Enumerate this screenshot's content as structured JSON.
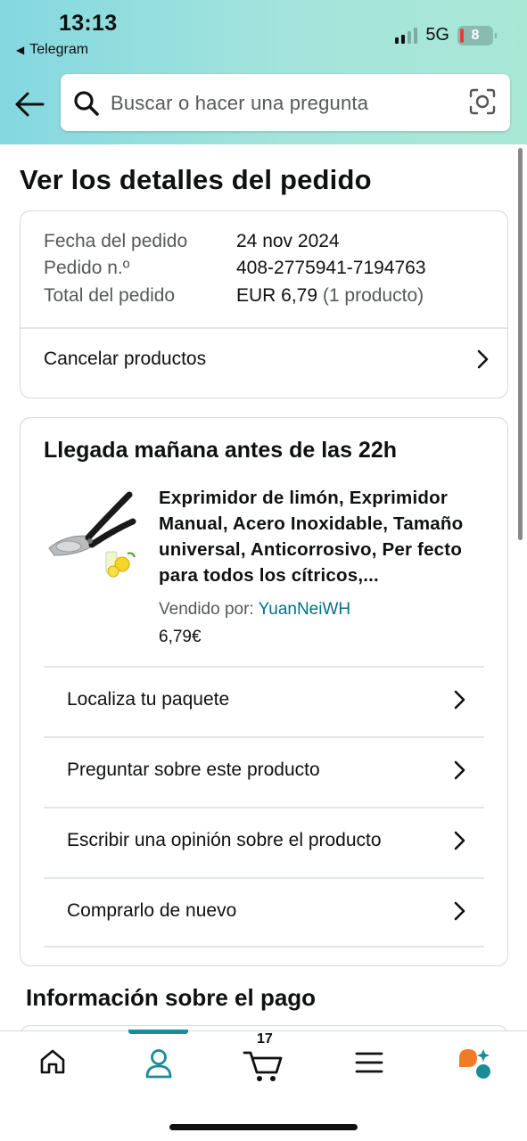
{
  "status_bar": {
    "time": "13:13",
    "back_app": "Telegram",
    "network": "5G",
    "battery": "8"
  },
  "search": {
    "placeholder": "Buscar o hacer una pregunta"
  },
  "page_title": "Ver los detalles del pedido",
  "order_summary": {
    "date_label": "Fecha del pedido",
    "date_value": "24 nov 2024",
    "number_label": "Pedido n.º",
    "number_value": "408-2775941-7194763",
    "total_label": "Total del pedido",
    "total_value": "EUR 6,79",
    "total_count": "(1 producto)",
    "cancel_label": "Cancelar productos"
  },
  "shipment": {
    "arrival": "Llegada mañana antes de las 22h",
    "product_title": "Exprimidor de limón, Exprimidor Manual, Acero Inoxidable, Tamaño universal, Anticorrosivo, Per fecto para todos los cítricos,...",
    "sold_by_label": "Vendido por:",
    "seller": "YuanNeiWH",
    "price": "6,79€",
    "actions": [
      {
        "label": "Localiza tu paquete"
      },
      {
        "label": "Preguntar sobre este producto"
      },
      {
        "label": "Escribir una opinión sobre el producto"
      },
      {
        "label": "Comprarlo de nuevo"
      }
    ]
  },
  "payment_heading": "Información sobre el pago",
  "tabbar": {
    "cart_count": "17",
    "icons": [
      "home-icon",
      "account-icon",
      "cart-icon",
      "menu-icon",
      "assistant-icon"
    ],
    "accent": "#1a8c99"
  }
}
